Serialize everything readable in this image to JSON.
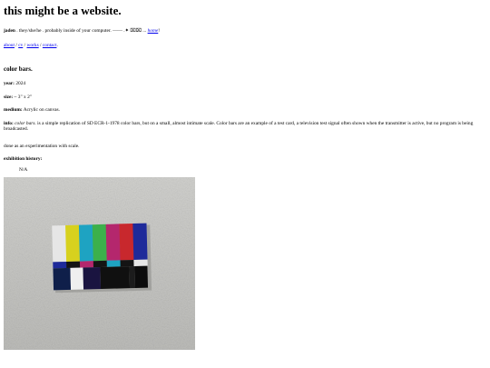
{
  "site": {
    "title": "this might be a website.",
    "author": "jaden",
    "tagline": " . they/she/he . probably inside of your computer. —— .✦ ⌧⌧ ... ",
    "home_link": "home",
    "home_suffix": "!"
  },
  "nav": {
    "links": [
      "about",
      "cv",
      "works",
      "contact"
    ],
    "separator": " / ",
    "terminator": "."
  },
  "artwork": {
    "title": "color bars.",
    "year_label": "year:",
    "year": "2024",
    "size_label": "size:",
    "size": "~ 3\" x 2\"",
    "medium_label": "medium:",
    "medium": "Acrylic on canvas.",
    "info_label": "info:",
    "info_title": "color bars.",
    "info_text": " is a simple replication of SD ECR-1-1978 color bars, but on a small, almost intimate scale. Color bars are an example of a test card, a television test signal often shown when the transmitter is active, but no program is being broadcasted.",
    "note": "done as an experimentation with scale.",
    "exhibition_label": "exhibition history:",
    "exhibition": "N/A"
  },
  "colors": {
    "link": "#0000ee",
    "wall": "#c9c9c6",
    "bars_top": [
      "#e6e6e6",
      "#d7d11e",
      "#1ea3c2",
      "#3cb04b",
      "#b4276d",
      "#c8282d",
      "#1e2a9a"
    ],
    "bars_mid": [
      "#1e2a9a",
      "#141414",
      "#b4276d",
      "#141414",
      "#1ea3c2",
      "#141414",
      "#e6e6e6"
    ]
  }
}
